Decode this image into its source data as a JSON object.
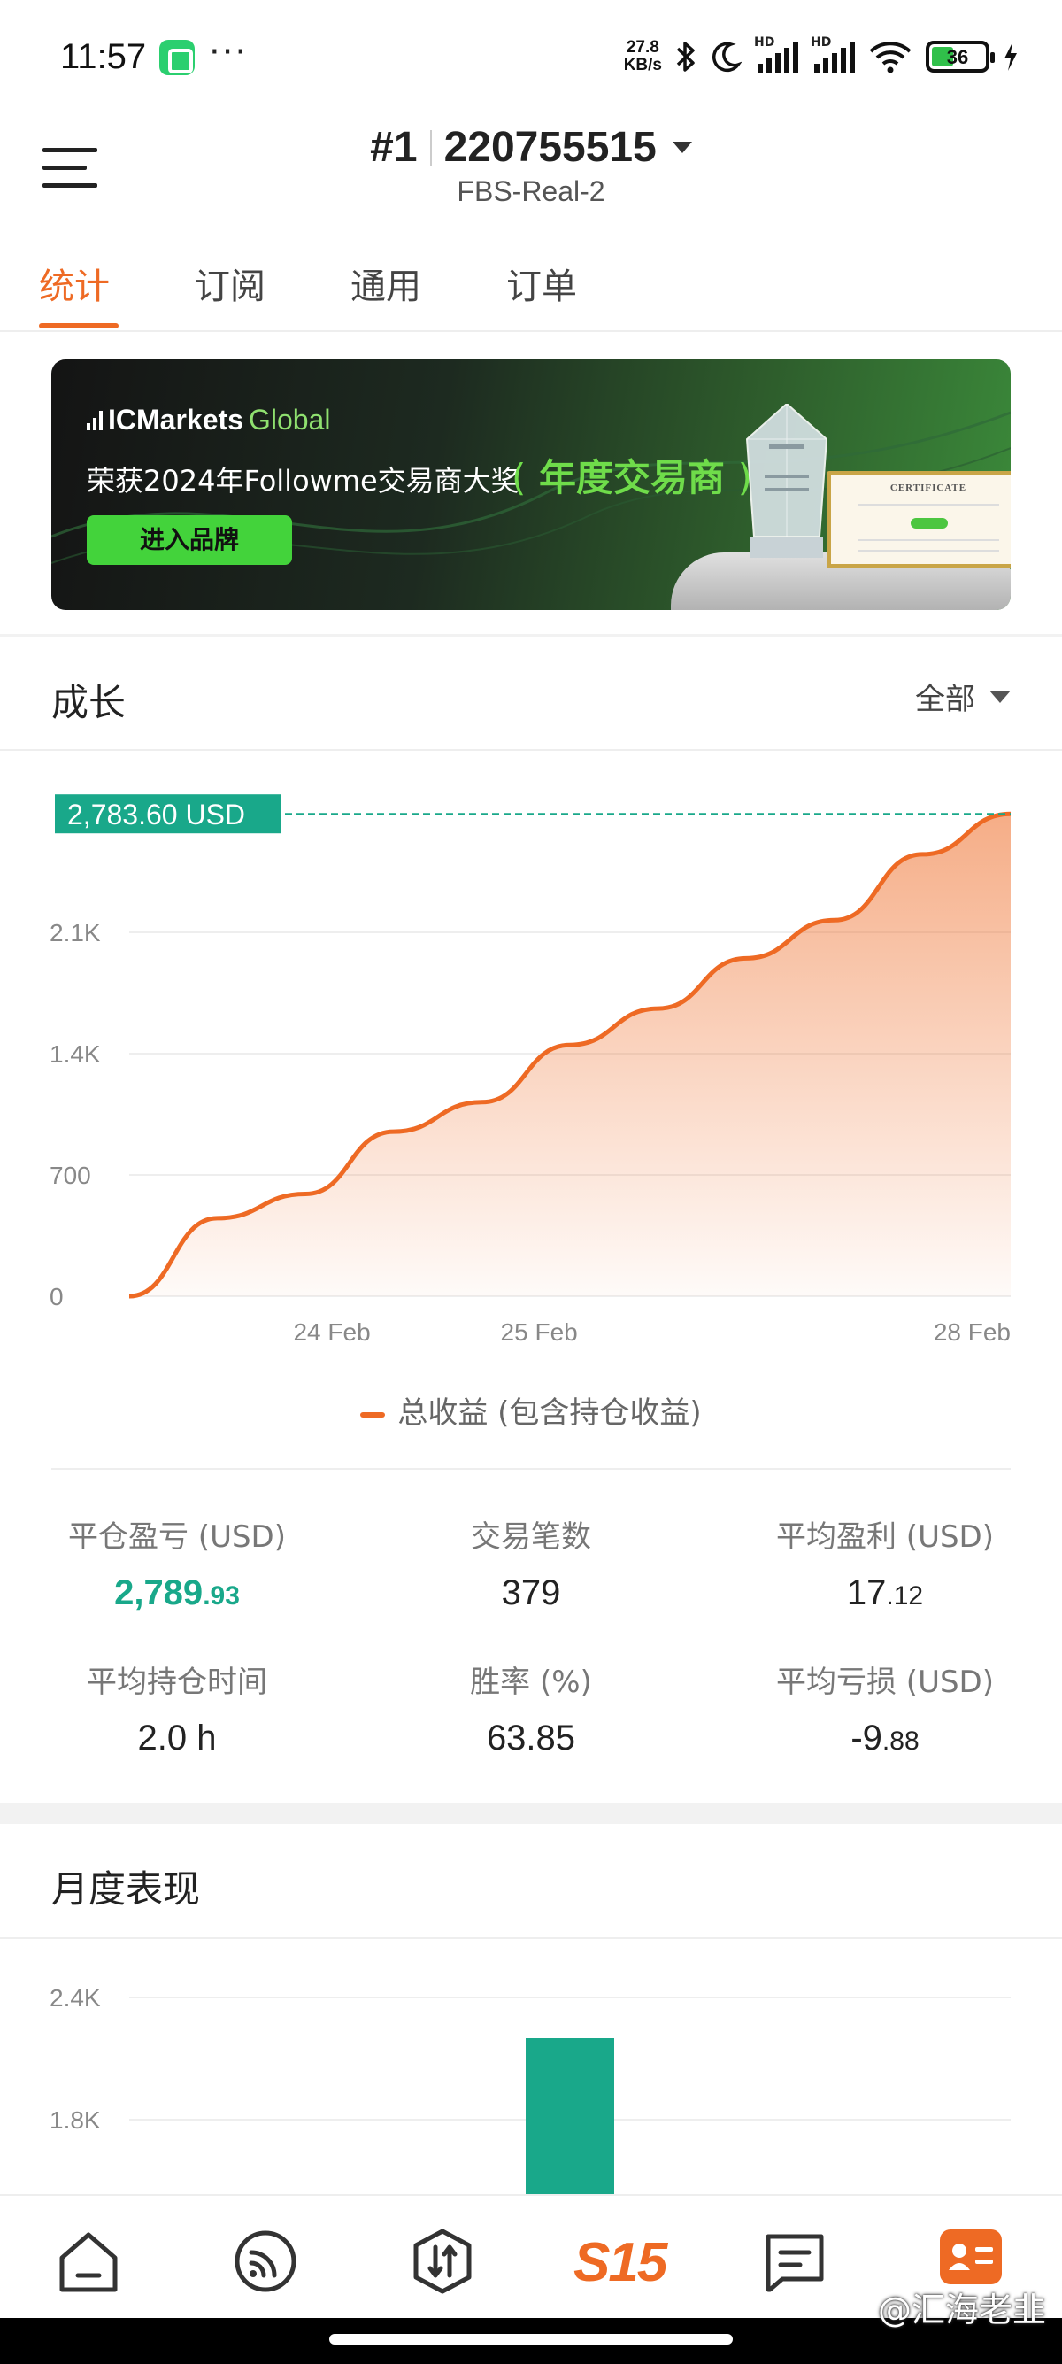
{
  "status_bar": {
    "time": "11:57",
    "dots": "···",
    "net_speed_value": "27.8",
    "net_speed_unit": "KB/s",
    "hd_label": "HD",
    "battery": "36"
  },
  "header": {
    "rank": "#1",
    "account_id": "220755515",
    "server": "FBS-Real-2"
  },
  "tabs": [
    {
      "label": "统计"
    },
    {
      "label": "订阅"
    },
    {
      "label": "通用"
    },
    {
      "label": "订单"
    }
  ],
  "banner": {
    "brand_main": "ICMarkets",
    "brand_sub": "Global",
    "award_text": "荣获2024年Followme交易商大奖",
    "award_title": "年度交易商",
    "laurel_left": "(",
    "laurel_right": ")",
    "button_label": "进入品牌",
    "certificate_title": "CERTIFICATE"
  },
  "growth": {
    "title": "成长",
    "filter": "全部"
  },
  "chart_data": [
    {
      "type": "area",
      "y_ticks": [
        "0",
        "700",
        "1.4K",
        "2.1K"
      ],
      "x_ticks": [
        "24 Feb",
        "25 Feb",
        "28 Feb"
      ],
      "ylim": [
        0,
        2800
      ],
      "current_label": "2,783.60 USD",
      "current_value": 2783.6,
      "series": [
        {
          "name": "总收益 (包含持仓收益)",
          "x": [
            0,
            0.1,
            0.2,
            0.3,
            0.4,
            0.5,
            0.6,
            0.7,
            0.8,
            0.9,
            1.0
          ],
          "values": [
            0,
            450,
            590,
            950,
            1120,
            1450,
            1660,
            1950,
            2170,
            2550,
            2783.6
          ]
        }
      ],
      "color": "#ee6a24"
    },
    {
      "type": "bar",
      "y_ticks": [
        "2.4K",
        "1.8K"
      ],
      "ylim": [
        1200,
        2600
      ],
      "series": [
        {
          "values": [
            2200
          ]
        }
      ],
      "color": "#19a88a"
    }
  ],
  "stats": [
    {
      "label": "平仓盈亏 (USD)",
      "value_main": "2,789",
      "value_small": ".93",
      "highlight": true
    },
    {
      "label": "交易笔数",
      "value_main": "379",
      "value_small": "",
      "highlight": false
    },
    {
      "label": "平均盈利 (USD)",
      "value_main": "17",
      "value_small": ".12",
      "highlight": false
    },
    {
      "label": "平均持仓时间",
      "value_main": "2.0 h",
      "value_small": "",
      "highlight": false
    },
    {
      "label": "胜率 (%)",
      "value_main": "63.85",
      "value_small": "",
      "highlight": false
    },
    {
      "label": "平均亏损 (USD)",
      "value_main": "-9",
      "value_small": ".88",
      "highlight": false
    }
  ],
  "monthly": {
    "title": "月度表现"
  },
  "bottom_nav": {
    "s15_label": "S15"
  },
  "watermark": "@汇海老韭",
  "colors": {
    "accent": "#ee6a24",
    "positive": "#19a88a"
  }
}
